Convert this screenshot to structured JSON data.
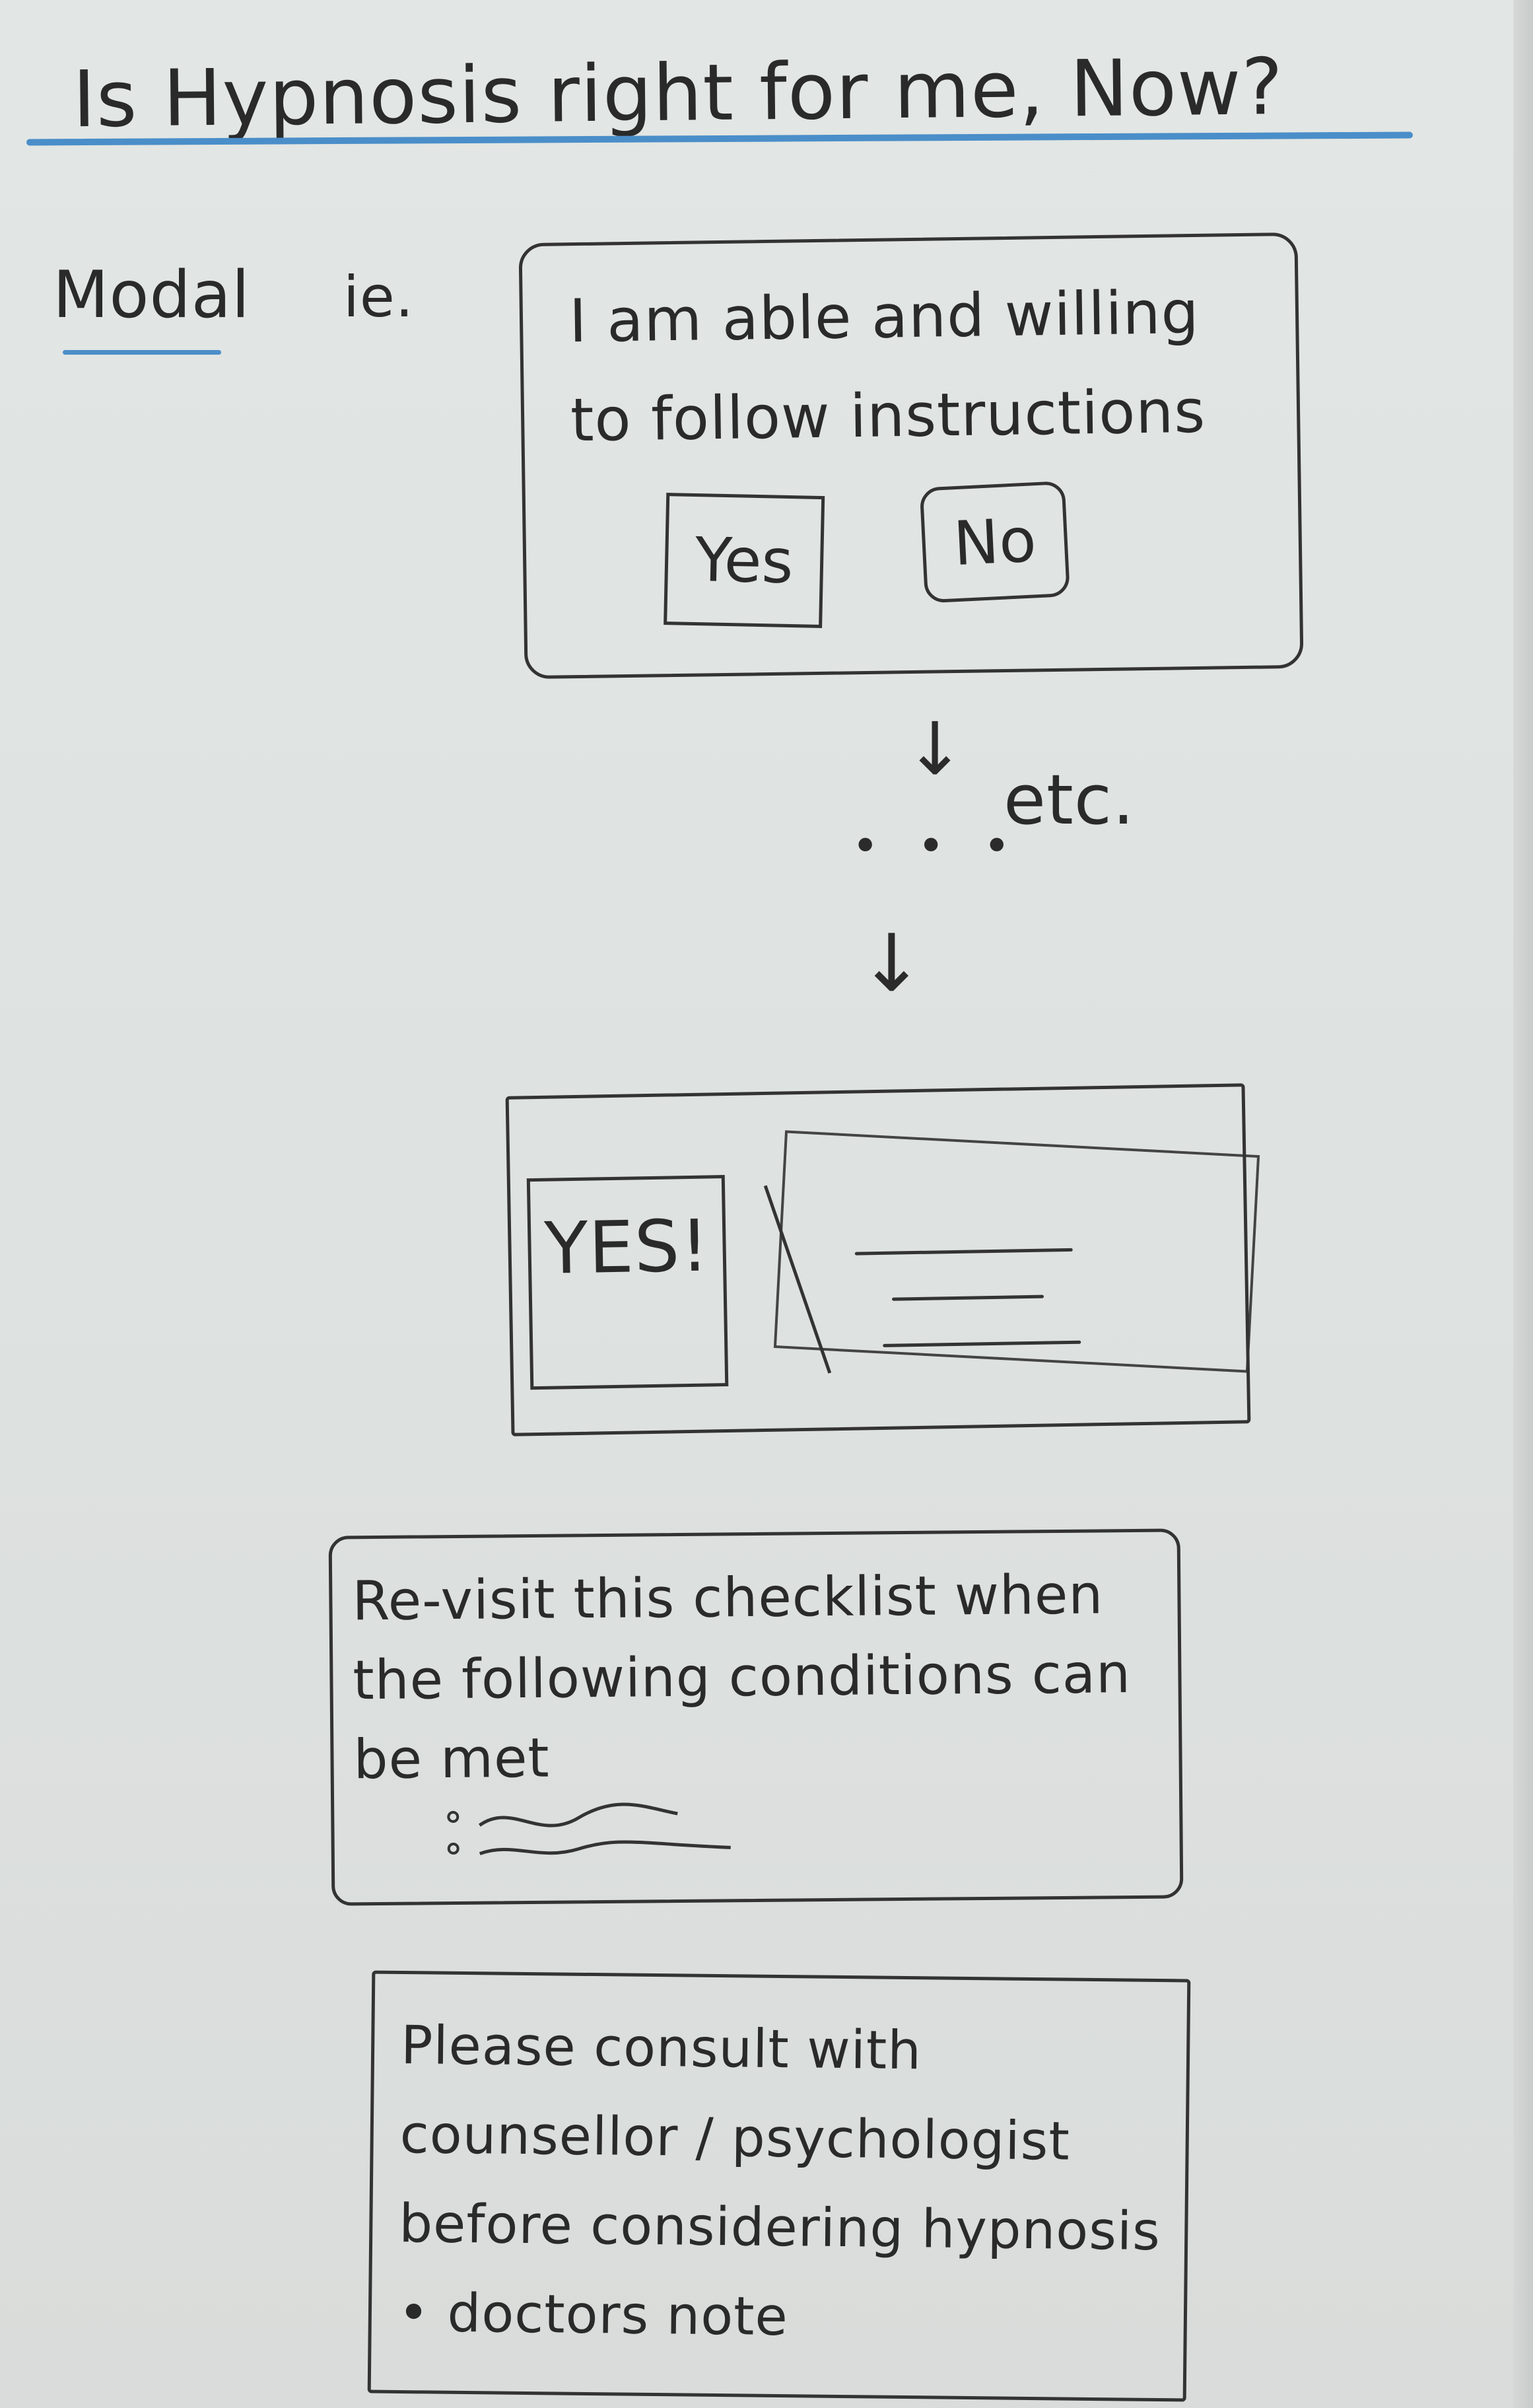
{
  "title": "Is Hypnosis right for me, Now?",
  "modal_section": {
    "label": "Modal",
    "label_suffix": "ie.",
    "question": "I am able and willing to follow instructions",
    "yes_label": "Yes",
    "no_label": "No"
  },
  "flow": {
    "etc_label": "etc.",
    "ellipsis": "• • •"
  },
  "result_card": {
    "badge_label": "YES!"
  },
  "revisit_card": {
    "text": "Re-visit this checklist when the following conditions can be met"
  },
  "consult_card": {
    "text": "Please consult with counsellor / psychologist before considering hypnosis • doctors note"
  }
}
